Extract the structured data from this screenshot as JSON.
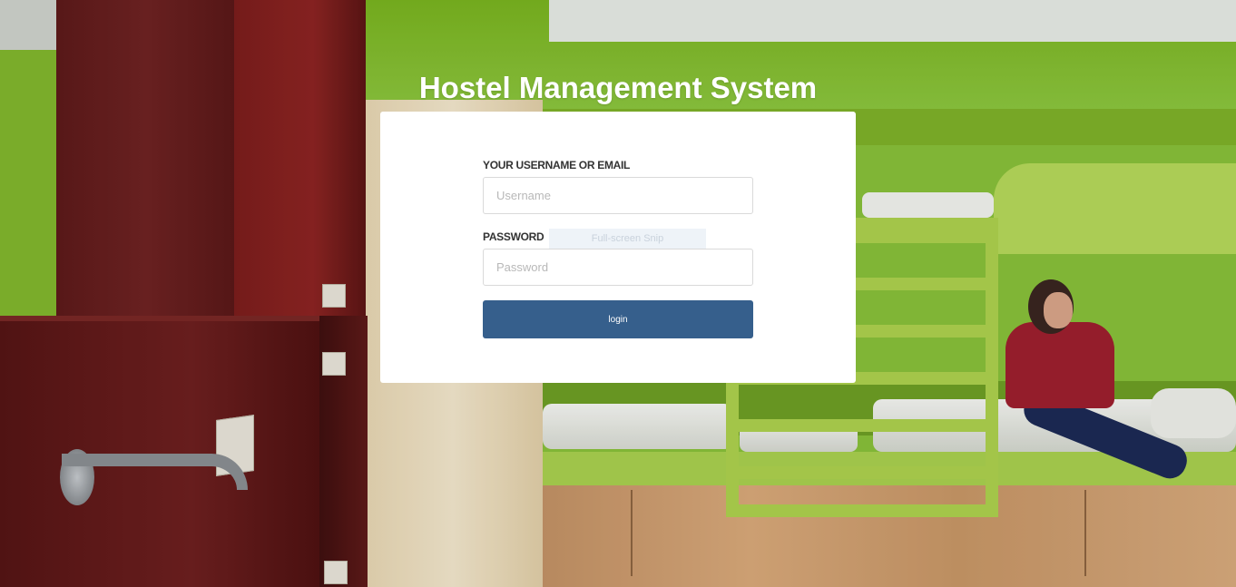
{
  "app": {
    "title": "Hostel Management System"
  },
  "login_form": {
    "username_label": "YOUR USERNAME OR EMAIL",
    "username_placeholder": "Username",
    "username_value": "",
    "password_label": "PASSWORD",
    "password_placeholder": "Password",
    "password_value": "",
    "login_button_label": "login"
  },
  "overlay": {
    "snip_tooltip": "Full-screen Snip"
  },
  "colors": {
    "button_bg": "#365f8c",
    "card_bg": "#ffffff",
    "title_text": "#ffffff"
  }
}
